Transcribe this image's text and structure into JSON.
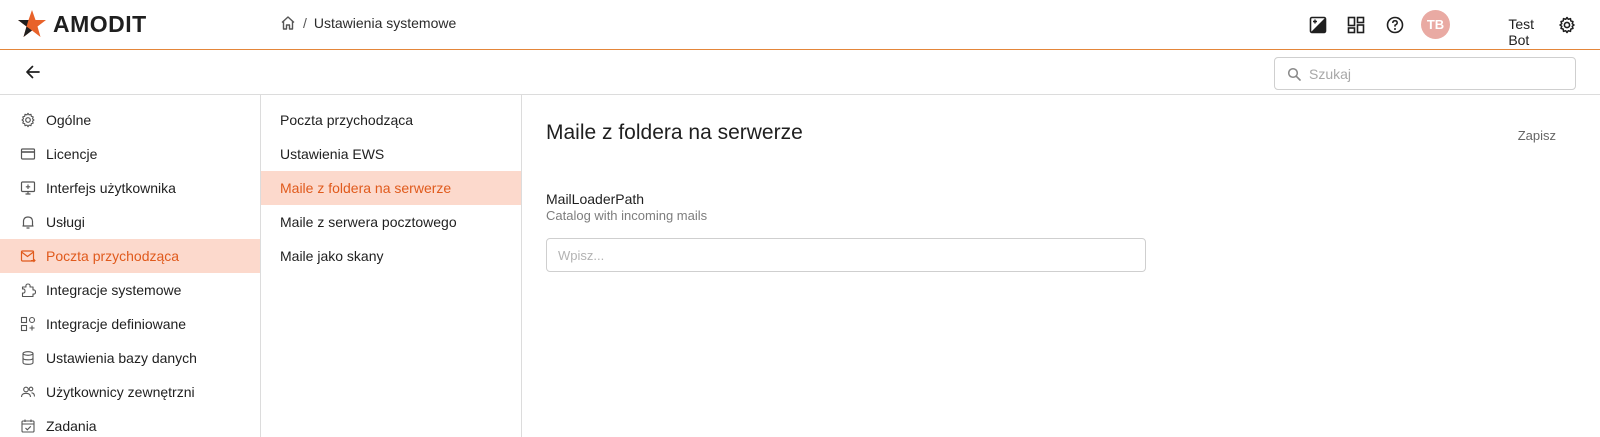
{
  "app": {
    "brand": "AMODIT",
    "accent_color": "#e05a1c",
    "active_bg": "#fcd9cc"
  },
  "breadcrumb": {
    "home_icon": "home-icon",
    "separator": "/",
    "current": "Ustawienia systemowe"
  },
  "header": {
    "icons": [
      "image-icon",
      "dashboard-icon",
      "help-icon",
      "settings-icon"
    ],
    "user": {
      "initials": "TB",
      "name": "Test Bot"
    }
  },
  "toolbar": {
    "search_placeholder": "Szukaj"
  },
  "sidebar": {
    "items": [
      {
        "label": "Ogólne",
        "icon": "gear-icon",
        "active": false
      },
      {
        "label": "Licencje",
        "icon": "card-icon",
        "active": false
      },
      {
        "label": "Interfejs użytkownika",
        "icon": "monitor-icon",
        "active": false
      },
      {
        "label": "Usługi",
        "icon": "bell-icon",
        "active": false
      },
      {
        "label": "Poczta przychodząca",
        "icon": "mail-icon",
        "active": true
      },
      {
        "label": "Integracje systemowe",
        "icon": "puzzle-icon",
        "active": false
      },
      {
        "label": "Integracje definiowane",
        "icon": "grid-plus-icon",
        "active": false
      },
      {
        "label": "Ustawienia bazy danych",
        "icon": "database-icon",
        "active": false
      },
      {
        "label": "Użytkownicy zewnętrzni",
        "icon": "users-icon",
        "active": false
      },
      {
        "label": "Zadania",
        "icon": "calendar-check-icon",
        "active": false
      }
    ]
  },
  "subnav": {
    "items": [
      {
        "label": "Poczta przychodząca",
        "active": false
      },
      {
        "label": "Ustawienia EWS",
        "active": false
      },
      {
        "label": "Maile z foldera na serwerze",
        "active": true
      },
      {
        "label": "Maile z serwera pocztowego",
        "active": false
      },
      {
        "label": "Maile jako skany",
        "active": false
      }
    ]
  },
  "main": {
    "title": "Maile z foldera na serwerze",
    "save_label": "Zapisz",
    "field": {
      "label": "MailLoaderPath",
      "description": "Catalog with incoming mails",
      "placeholder": "Wpisz...",
      "value": ""
    }
  }
}
